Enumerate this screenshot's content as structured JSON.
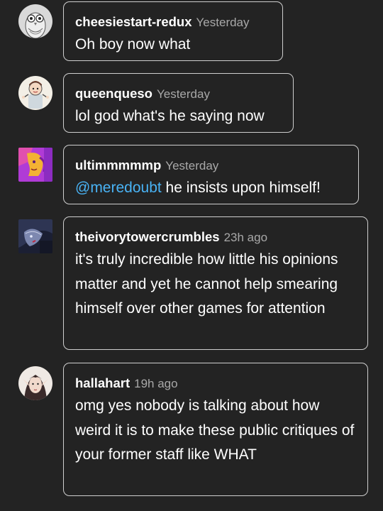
{
  "comments": [
    {
      "username": "cheesiestart-redux",
      "timestamp": "Yesterday",
      "text": "Oh boy now what",
      "avatar": "owl-drawing-avatar"
    },
    {
      "username": "queenqueso",
      "timestamp": "Yesterday",
      "text": "lol god what's he saying now",
      "avatar": "cartoon-character-avatar"
    },
    {
      "username": "ultimmmmmp",
      "timestamp": "Yesterday",
      "mention": "@meredoubt",
      "text": " he insists upon himself!",
      "avatar": "pink-purple-face-avatar"
    },
    {
      "username": "theivorytowercrumbles",
      "timestamp": "23h ago",
      "text": "it's truly incredible how little his opinions matter and yet he cannot help smearing himself over other games for attention",
      "avatar": "dark-portrait-avatar"
    },
    {
      "username": "hallahart",
      "timestamp": "19h ago",
      "text": "omg yes nobody is talking about how weird it is to make these public critiques of your former staff like WHAT",
      "avatar": "elf-portrait-avatar"
    }
  ],
  "colors": {
    "background": "#232323",
    "bubble_border": "#cfcfcf",
    "timestamp": "#a8a8a8",
    "mention": "#49b3f5"
  }
}
